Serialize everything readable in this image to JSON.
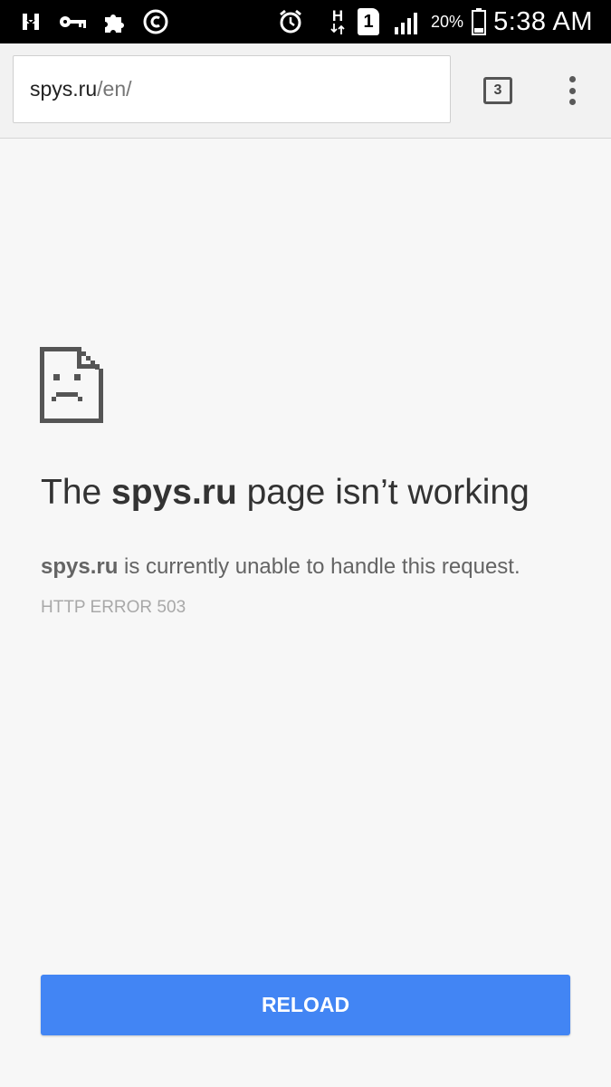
{
  "status_bar": {
    "time": "5:38 AM",
    "battery_percent": "20%",
    "sim_slot": "1",
    "network_type": "H",
    "icons": [
      "notification-h-icon",
      "key-icon",
      "puzzle-icon",
      "copyright-app-icon",
      "alarm-icon",
      "data-transfer-icon",
      "sim-icon",
      "signal-icon",
      "battery-icon"
    ]
  },
  "toolbar": {
    "url_host": "spys.ru",
    "url_path": "/en/",
    "tab_count": "3"
  },
  "error": {
    "title_prefix": "The ",
    "title_host": "spys.ru",
    "title_suffix": " page isn’t working",
    "desc_host": "spys.ru",
    "desc_text": " is currently unable to handle this request.",
    "code": "HTTP ERROR 503"
  },
  "actions": {
    "reload_label": "RELOAD"
  },
  "colors": {
    "accent": "#4285f4",
    "background": "#f7f7f7"
  }
}
